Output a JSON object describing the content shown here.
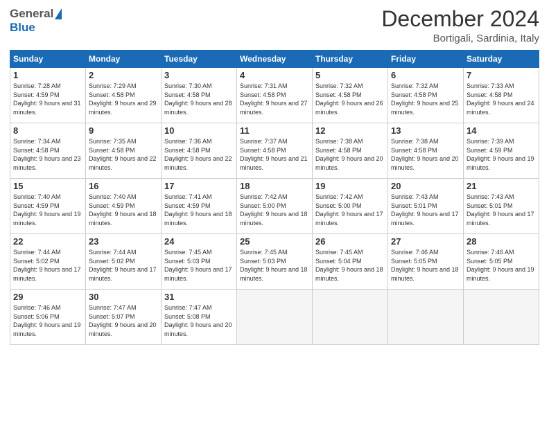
{
  "header": {
    "logo_general": "General",
    "logo_blue": "Blue",
    "month_title": "December 2024",
    "location": "Bortigali, Sardinia, Italy"
  },
  "days_of_week": [
    "Sunday",
    "Monday",
    "Tuesday",
    "Wednesday",
    "Thursday",
    "Friday",
    "Saturday"
  ],
  "weeks": [
    [
      {
        "day": "1",
        "sunrise": "7:28 AM",
        "sunset": "4:59 PM",
        "daylight": "9 hours and 31 minutes."
      },
      {
        "day": "2",
        "sunrise": "7:29 AM",
        "sunset": "4:58 PM",
        "daylight": "9 hours and 29 minutes."
      },
      {
        "day": "3",
        "sunrise": "7:30 AM",
        "sunset": "4:58 PM",
        "daylight": "9 hours and 28 minutes."
      },
      {
        "day": "4",
        "sunrise": "7:31 AM",
        "sunset": "4:58 PM",
        "daylight": "9 hours and 27 minutes."
      },
      {
        "day": "5",
        "sunrise": "7:32 AM",
        "sunset": "4:58 PM",
        "daylight": "9 hours and 26 minutes."
      },
      {
        "day": "6",
        "sunrise": "7:32 AM",
        "sunset": "4:58 PM",
        "daylight": "9 hours and 25 minutes."
      },
      {
        "day": "7",
        "sunrise": "7:33 AM",
        "sunset": "4:58 PM",
        "daylight": "9 hours and 24 minutes."
      }
    ],
    [
      {
        "day": "8",
        "sunrise": "7:34 AM",
        "sunset": "4:58 PM",
        "daylight": "9 hours and 23 minutes."
      },
      {
        "day": "9",
        "sunrise": "7:35 AM",
        "sunset": "4:58 PM",
        "daylight": "9 hours and 22 minutes."
      },
      {
        "day": "10",
        "sunrise": "7:36 AM",
        "sunset": "4:58 PM",
        "daylight": "9 hours and 22 minutes."
      },
      {
        "day": "11",
        "sunrise": "7:37 AM",
        "sunset": "4:58 PM",
        "daylight": "9 hours and 21 minutes."
      },
      {
        "day": "12",
        "sunrise": "7:38 AM",
        "sunset": "4:58 PM",
        "daylight": "9 hours and 20 minutes."
      },
      {
        "day": "13",
        "sunrise": "7:38 AM",
        "sunset": "4:58 PM",
        "daylight": "9 hours and 20 minutes."
      },
      {
        "day": "14",
        "sunrise": "7:39 AM",
        "sunset": "4:59 PM",
        "daylight": "9 hours and 19 minutes."
      }
    ],
    [
      {
        "day": "15",
        "sunrise": "7:40 AM",
        "sunset": "4:59 PM",
        "daylight": "9 hours and 19 minutes."
      },
      {
        "day": "16",
        "sunrise": "7:40 AM",
        "sunset": "4:59 PM",
        "daylight": "9 hours and 18 minutes."
      },
      {
        "day": "17",
        "sunrise": "7:41 AM",
        "sunset": "4:59 PM",
        "daylight": "9 hours and 18 minutes."
      },
      {
        "day": "18",
        "sunrise": "7:42 AM",
        "sunset": "5:00 PM",
        "daylight": "9 hours and 18 minutes."
      },
      {
        "day": "19",
        "sunrise": "7:42 AM",
        "sunset": "5:00 PM",
        "daylight": "9 hours and 17 minutes."
      },
      {
        "day": "20",
        "sunrise": "7:43 AM",
        "sunset": "5:01 PM",
        "daylight": "9 hours and 17 minutes."
      },
      {
        "day": "21",
        "sunrise": "7:43 AM",
        "sunset": "5:01 PM",
        "daylight": "9 hours and 17 minutes."
      }
    ],
    [
      {
        "day": "22",
        "sunrise": "7:44 AM",
        "sunset": "5:02 PM",
        "daylight": "9 hours and 17 minutes."
      },
      {
        "day": "23",
        "sunrise": "7:44 AM",
        "sunset": "5:02 PM",
        "daylight": "9 hours and 17 minutes."
      },
      {
        "day": "24",
        "sunrise": "7:45 AM",
        "sunset": "5:03 PM",
        "daylight": "9 hours and 17 minutes."
      },
      {
        "day": "25",
        "sunrise": "7:45 AM",
        "sunset": "5:03 PM",
        "daylight": "9 hours and 18 minutes."
      },
      {
        "day": "26",
        "sunrise": "7:45 AM",
        "sunset": "5:04 PM",
        "daylight": "9 hours and 18 minutes."
      },
      {
        "day": "27",
        "sunrise": "7:46 AM",
        "sunset": "5:05 PM",
        "daylight": "9 hours and 18 minutes."
      },
      {
        "day": "28",
        "sunrise": "7:46 AM",
        "sunset": "5:05 PM",
        "daylight": "9 hours and 19 minutes."
      }
    ],
    [
      {
        "day": "29",
        "sunrise": "7:46 AM",
        "sunset": "5:06 PM",
        "daylight": "9 hours and 19 minutes."
      },
      {
        "day": "30",
        "sunrise": "7:47 AM",
        "sunset": "5:07 PM",
        "daylight": "9 hours and 20 minutes."
      },
      {
        "day": "31",
        "sunrise": "7:47 AM",
        "sunset": "5:08 PM",
        "daylight": "9 hours and 20 minutes."
      },
      null,
      null,
      null,
      null
    ]
  ],
  "labels": {
    "sunrise": "Sunrise:",
    "sunset": "Sunset:",
    "daylight": "Daylight:"
  }
}
